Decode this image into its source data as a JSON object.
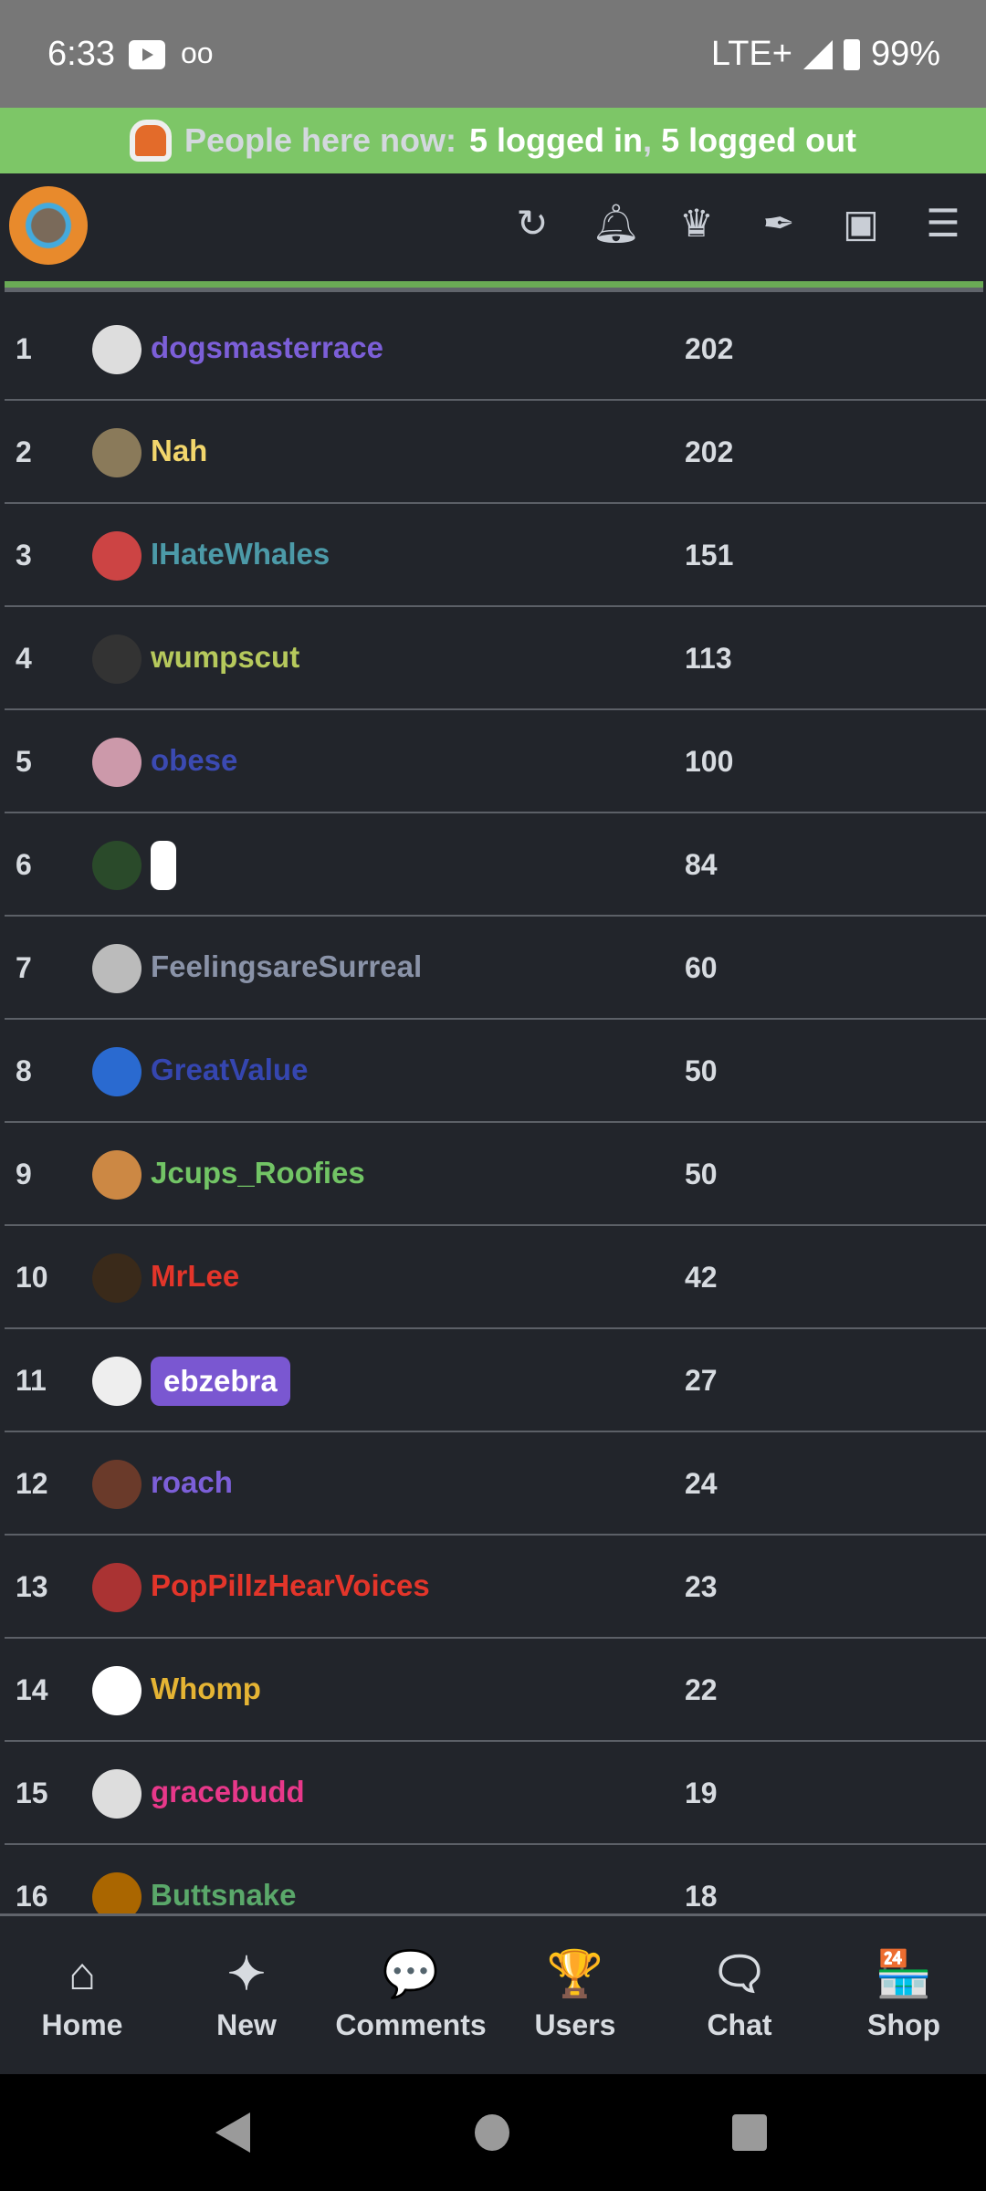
{
  "status_bar": {
    "time": "6:33",
    "network": "LTE+",
    "battery": "99%"
  },
  "banner": {
    "label": "People here now:",
    "logged_in": "5 logged in",
    "separator": ",",
    "logged_out": "5 logged out"
  },
  "header": {
    "icons": [
      "refresh-icon",
      "bell-icon",
      "crown-icon",
      "feather-icon",
      "ticket-icon",
      "menu-icon"
    ]
  },
  "leaderboard": [
    {
      "rank": "1",
      "name": "dogsmasterrace",
      "score": "202",
      "color": "#7c5fd8"
    },
    {
      "rank": "2",
      "name": "Nah",
      "score": "202",
      "color": "#f2d66c"
    },
    {
      "rank": "3",
      "name": "IHateWhales",
      "score": "151",
      "color": "#4c9aa8"
    },
    {
      "rank": "4",
      "name": "wumpscut",
      "score": "113",
      "color": "#b6c95c"
    },
    {
      "rank": "5",
      "name": "obese",
      "score": "100",
      "color": "#3b4ab2"
    },
    {
      "rank": "6",
      "name": "",
      "score": "84",
      "color": "#22252b",
      "pill": "#ffffff"
    },
    {
      "rank": "7",
      "name": "FeelingsareSurreal",
      "score": "60",
      "color": "#8a93a8"
    },
    {
      "rank": "8",
      "name": "GreatValue",
      "score": "50",
      "color": "#3546b0"
    },
    {
      "rank": "9",
      "name": "Jcups_Roofies",
      "score": "50",
      "color": "#72c465"
    },
    {
      "rank": "10",
      "name": "MrLee",
      "score": "42",
      "color": "#e3352a"
    },
    {
      "rank": "11",
      "name": "ebzebra",
      "score": "27",
      "color": "#ffffff",
      "pill": "#7a57d1"
    },
    {
      "rank": "12",
      "name": "roach",
      "score": "24",
      "color": "#7c5fd8"
    },
    {
      "rank": "13",
      "name": "PopPillzHearVoices",
      "score": "23",
      "color": "#e3352a"
    },
    {
      "rank": "14",
      "name": "Whomp",
      "score": "22",
      "color": "#e5b434"
    },
    {
      "rank": "15",
      "name": "gracebudd",
      "score": "19",
      "color": "#e8388a"
    },
    {
      "rank": "16",
      "name": "Buttsnake",
      "score": "18",
      "color": "#5aa86a"
    }
  ],
  "bottom_nav": [
    {
      "label": "Home",
      "icon": "home-icon",
      "glyph": "⌂"
    },
    {
      "label": "New",
      "icon": "sparkles-icon",
      "glyph": "✦"
    },
    {
      "label": "Comments",
      "icon": "comment-icon",
      "glyph": "💬"
    },
    {
      "label": "Users",
      "icon": "trophy-icon",
      "glyph": "🏆"
    },
    {
      "label": "Chat",
      "icon": "chat-icon",
      "glyph": "🗨"
    },
    {
      "label": "Shop",
      "icon": "store-icon",
      "glyph": "🏪"
    }
  ]
}
